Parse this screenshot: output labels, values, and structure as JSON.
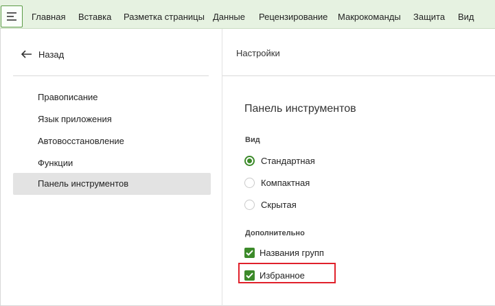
{
  "ribbon": {
    "menu_icon": "hamburger-icon",
    "tabs": [
      {
        "label": "Главная"
      },
      {
        "label": "Вставка"
      },
      {
        "label": "Разметка страницы"
      },
      {
        "label": "Данные"
      },
      {
        "label": "Рецензирование"
      },
      {
        "label": "Макрокоманды"
      },
      {
        "label": "Защита"
      },
      {
        "label": "Вид"
      }
    ]
  },
  "left_pane": {
    "back": {
      "label": "Назад",
      "icon": "arrow-left-icon"
    },
    "items": [
      {
        "label": "Правописание"
      },
      {
        "label": "Язык приложения"
      },
      {
        "label": "Автовосстановление"
      },
      {
        "label": "Функции"
      },
      {
        "label": "Панель инструментов",
        "selected": true
      }
    ]
  },
  "right_pane": {
    "header": "Настройки",
    "section_title": "Панель инструментов",
    "view_group": {
      "label": "Вид",
      "options": [
        {
          "label": "Стандартная",
          "checked": true
        },
        {
          "label": "Компактная",
          "checked": false
        },
        {
          "label": "Скрытая",
          "checked": false
        }
      ]
    },
    "extra_group": {
      "label": "Дополнительно",
      "options": [
        {
          "label": "Названия групп",
          "checked": true
        },
        {
          "label": "Избранное",
          "checked": true
        }
      ]
    }
  },
  "colors": {
    "ribbon_bg": "#e6f2e1",
    "accent": "#3c8a2a",
    "selected_bg": "#e3e3e3",
    "highlight": "#e0202a"
  }
}
